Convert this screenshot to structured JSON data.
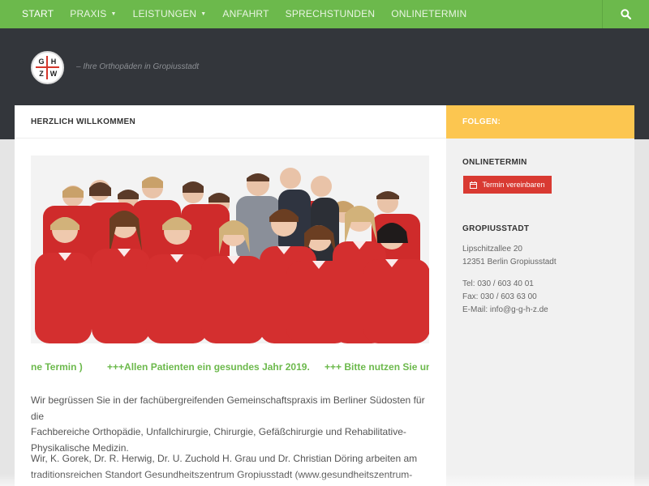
{
  "nav": {
    "items": [
      {
        "label": "START",
        "active": true,
        "caret": false
      },
      {
        "label": "PRAXIS",
        "active": false,
        "caret": true
      },
      {
        "label": "LEISTUNGEN",
        "active": false,
        "caret": true
      },
      {
        "label": "ANFAHRT",
        "active": false,
        "caret": false
      },
      {
        "label": "SPRECHSTUNDEN",
        "active": false,
        "caret": false
      },
      {
        "label": "ONLINETERMIN",
        "active": false,
        "caret": false
      }
    ],
    "caret_glyph": "▼",
    "search_icon": "search-icon"
  },
  "header": {
    "logo": {
      "letters": [
        "G",
        "H",
        "Z",
        "W"
      ]
    },
    "tagline": "– Ihre Orthopäden in Gropiusstadt"
  },
  "main": {
    "title": "HERZLICH WILLKOMMEN",
    "ticker": {
      "segments": [
        "ne Termin )",
        "+++Allen Patienten ein gesundes Jahr 2019.",
        "+++ Bitte nutzen Sie unse"
      ]
    },
    "paragraphs": [
      {
        "lines": [
          "Wir begrüssen Sie in der fachübergreifenden Gemeinschaftspraxis im Berliner Südosten für die",
          "Fachbereiche Orthopädie, Unfallchirurgie, Chirurgie, Gefäßchirurgie und Rehabilitative-",
          "Physikalische Medizin."
        ]
      },
      {
        "lines": [
          "Wir, K. Gorek, Dr. R. Herwig, Dr. U. Zuchold H. Grau und Dr. Christian Döring arbeiten am",
          "traditionsreichen Standort Gesundheitszentrum Gropiusstadt (www.gesundheitszentrum-"
        ]
      }
    ]
  },
  "sidebar": {
    "follow_title": "FOLGEN:",
    "onlinetermin_title": "ONLINETERMIN",
    "button_label": "Termin vereinbaren",
    "location_title": "GROPIUSSTADT",
    "address": [
      "Lipschitzallee 20",
      "12351 Berlin Gropiusstadt"
    ],
    "contact": [
      "Tel: 030 / 603 40 01",
      "Fax: 030 / 603 63 00",
      "E-Mail: info@g-g-h-z.de"
    ]
  },
  "colors": {
    "nav_green": "#6cb94c",
    "header_dark": "#33363b",
    "follow_yellow": "#fcc650",
    "button_red": "#d93a32",
    "ticker_green": "#6cb94c"
  }
}
